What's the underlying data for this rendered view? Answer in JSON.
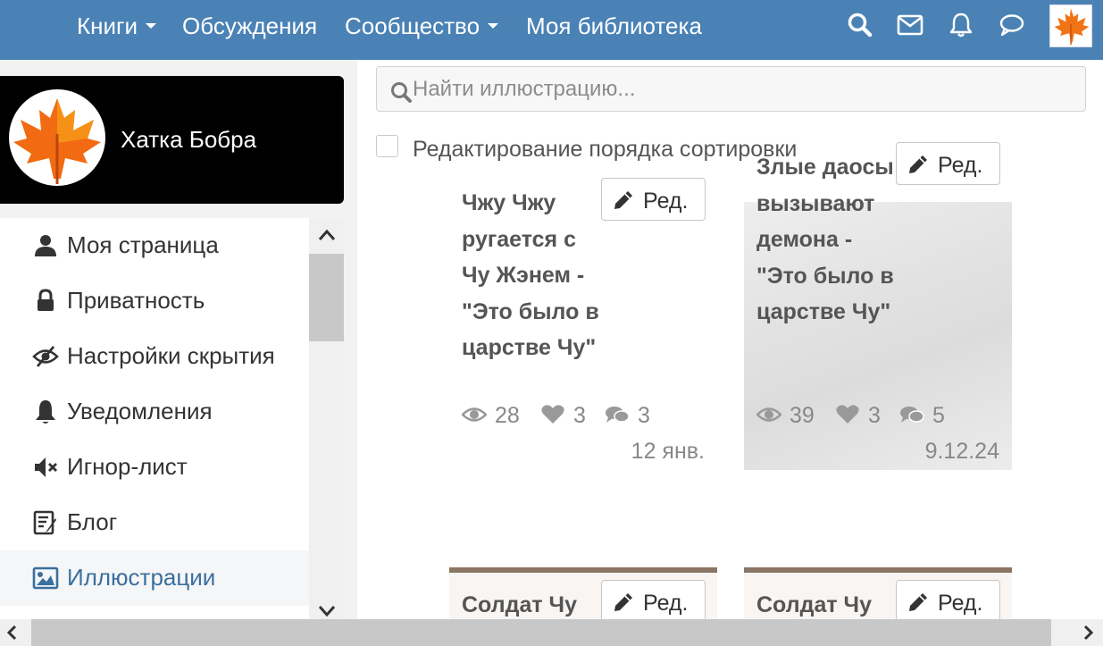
{
  "topnav": {
    "books": "Книги",
    "discussions": "Обсуждения",
    "community": "Сообщество",
    "my_library": "Моя библиотека"
  },
  "profile": {
    "name": "Хатка Бобра"
  },
  "menu": {
    "items": [
      {
        "label": "Моя страница",
        "icon": "user-icon"
      },
      {
        "label": "Приватность",
        "icon": "lock-icon"
      },
      {
        "label": "Настройки скрытия",
        "icon": "eye-slash-icon"
      },
      {
        "label": "Уведомления",
        "icon": "bell-icon"
      },
      {
        "label": "Игнор-лист",
        "icon": "mute-icon"
      },
      {
        "label": "Блог",
        "icon": "blog-icon"
      },
      {
        "label": "Иллюстрации",
        "icon": "image-icon",
        "active": true
      }
    ]
  },
  "search": {
    "placeholder": "Найти иллюстрацию..."
  },
  "sort_edit": {
    "label": "Редактирование порядка сортировки",
    "checked": false
  },
  "cards": [
    {
      "title": "Чжу Чжу ругается с Чу Жэнем - \"Это было в царстве Чу\"",
      "edit": "Ред.",
      "views": "28",
      "likes": "3",
      "comments": "3",
      "date": "12 янв."
    },
    {
      "title": "Злые даосы вызывают демона - \"Это было в царстве Чу\"",
      "edit": "Ред.",
      "views": "39",
      "likes": "3",
      "comments": "5",
      "date": "9.12.24"
    },
    {
      "title": "Солдат Чу",
      "edit": "Ред."
    },
    {
      "title": "Солдат Чу",
      "edit": "Ред."
    }
  ],
  "colors": {
    "topbar": "#4a82b5",
    "accent_link": "#3a6f9f",
    "card_topline": "#8b7564"
  }
}
